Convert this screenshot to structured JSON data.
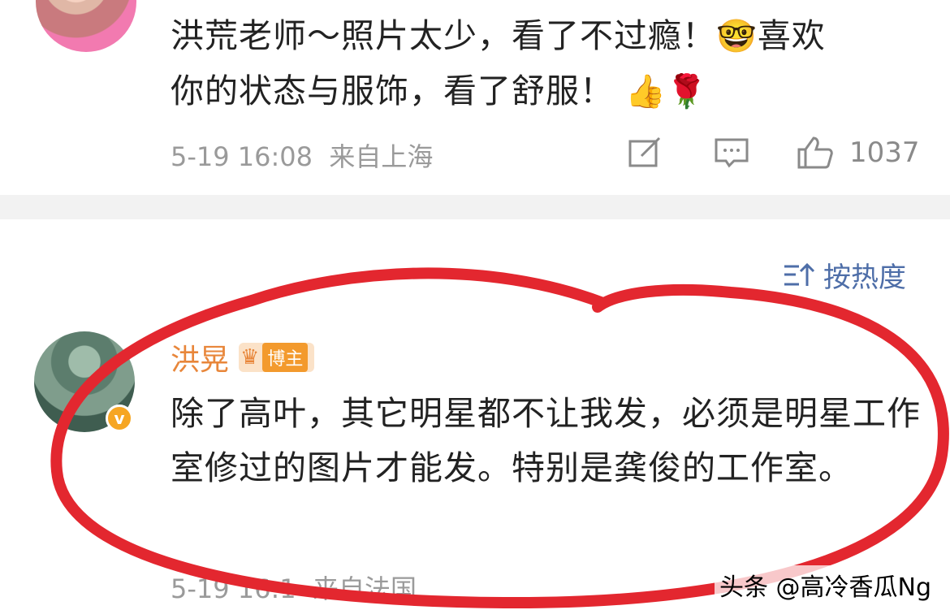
{
  "comment1": {
    "text_line1": "洪荒老师～照片太少，看了不过瘾！",
    "text_emoji1": "🤓",
    "text_line1_end": "喜欢",
    "text_line2": "你的状态与服饰，看了舒服！",
    "text_emoji2": "👍🌹",
    "date": "5-19 16:08",
    "location": "来自上海",
    "like_count": "1037"
  },
  "sort": {
    "label": "按热度",
    "icon": "sort-icon"
  },
  "comment2": {
    "author": "洪晃",
    "badge_label": "博主",
    "verified_mark": "v",
    "text": "除了高叶，其它明星都不让我发，必须是明星工作室修过的图片才能发。特别是龚俊的工作室。",
    "date": "5-19 16:1",
    "location": "来自法国"
  },
  "watermark": "头条 @高冷香瓜Ng",
  "colors": {
    "annotation_red": "#e3272f",
    "author_orange": "#e8863a",
    "sort_blue": "#4e6ea8"
  }
}
